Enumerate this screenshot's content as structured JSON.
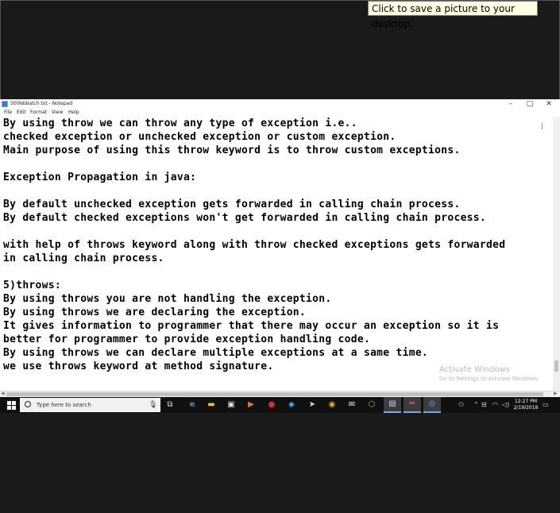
{
  "tooltip": {
    "text": "Click to save a picture to your desktop."
  },
  "window": {
    "title": "5thfebbatch.txt - Notepad",
    "controls": {
      "minimize": "–",
      "maximize": "□",
      "close": "✕"
    },
    "menu": [
      "File",
      "Edit",
      "Format",
      "View",
      "Help"
    ]
  },
  "document": {
    "lines": [
      "By using throw we can throw any type of exception i.e..",
      "checked exception or unchecked exception or custom exception.",
      "Main purpose of using this throw keyword is to throw custom exceptions.",
      "",
      "Exception Propagation in java:",
      "",
      "By default unchecked exception gets forwarded in calling chain process.",
      "By default checked exceptions won't get forwarded in calling chain process.",
      "",
      "with help of throws keyword along with throw checked exceptions gets forwarded",
      "in calling chain process.",
      "",
      "5)throws:",
      "By using throws you are not handling the exception.",
      "By using throws we are declaring the exception.",
      "It gives information to programmer that there may occur an exception so it is",
      "better for programmer to provide exception handling code.",
      "By using throws we can declare multiple exceptions at a same time.",
      "we use throws keyword at method signature."
    ]
  },
  "watermark": {
    "title": "Activate Windows",
    "subtitle": "Go to Settings to activate Windows."
  },
  "taskbar": {
    "search_placeholder": "Type here to search",
    "clock_time": "12:27 PM",
    "clock_date": "2/19/2018"
  }
}
